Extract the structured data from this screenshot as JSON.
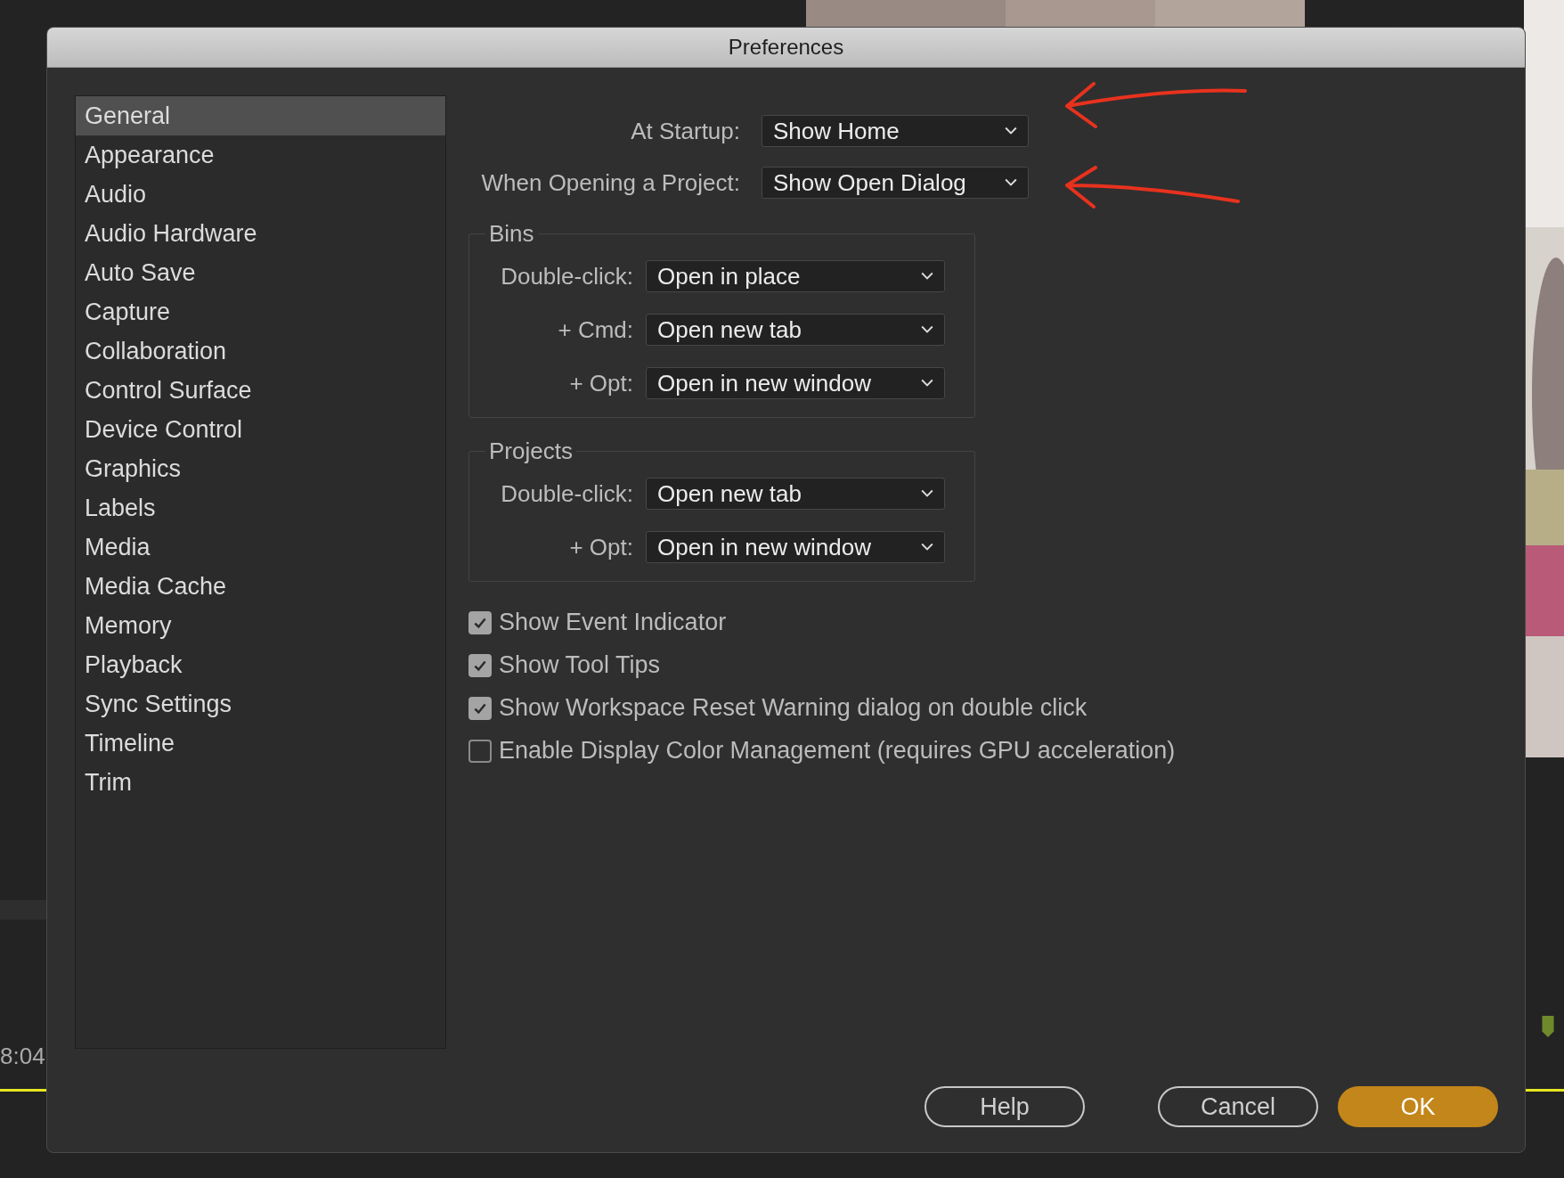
{
  "background_app": {
    "timecode": "8:04"
  },
  "window": {
    "title": "Preferences"
  },
  "sidebar": {
    "items": [
      {
        "label": "General",
        "selected": true
      },
      {
        "label": "Appearance",
        "selected": false
      },
      {
        "label": "Audio",
        "selected": false
      },
      {
        "label": "Audio Hardware",
        "selected": false
      },
      {
        "label": "Auto Save",
        "selected": false
      },
      {
        "label": "Capture",
        "selected": false
      },
      {
        "label": "Collaboration",
        "selected": false
      },
      {
        "label": "Control Surface",
        "selected": false
      },
      {
        "label": "Device Control",
        "selected": false
      },
      {
        "label": "Graphics",
        "selected": false
      },
      {
        "label": "Labels",
        "selected": false
      },
      {
        "label": "Media",
        "selected": false
      },
      {
        "label": "Media Cache",
        "selected": false
      },
      {
        "label": "Memory",
        "selected": false
      },
      {
        "label": "Playback",
        "selected": false
      },
      {
        "label": "Sync Settings",
        "selected": false
      },
      {
        "label": "Timeline",
        "selected": false
      },
      {
        "label": "Trim",
        "selected": false
      }
    ]
  },
  "startup_settings": [
    {
      "label": "At Startup:",
      "value": "Show Home"
    },
    {
      "label": "When Opening a Project:",
      "value": "Show Open Dialog"
    }
  ],
  "groups": [
    {
      "title": "Bins",
      "rows": [
        {
          "label": "Double-click:",
          "value": "Open in place"
        },
        {
          "label": "+ Cmd:",
          "value": "Open new tab"
        },
        {
          "label": "+ Opt:",
          "value": "Open in new window"
        }
      ]
    },
    {
      "title": "Projects",
      "rows": [
        {
          "label": "Double-click:",
          "value": "Open new tab"
        },
        {
          "label": "+ Opt:",
          "value": "Open in new window"
        }
      ]
    }
  ],
  "checkboxes": [
    {
      "label": "Show Event Indicator",
      "checked": true
    },
    {
      "label": "Show Tool Tips",
      "checked": true
    },
    {
      "label": "Show Workspace Reset Warning dialog on double click",
      "checked": true
    },
    {
      "label": "Enable Display Color Management (requires GPU acceleration)",
      "checked": false
    }
  ],
  "buttons": [
    {
      "label": "Help",
      "kind": "normal"
    },
    {
      "label": "Cancel",
      "kind": "normal"
    },
    {
      "label": "OK",
      "kind": "default"
    }
  ]
}
